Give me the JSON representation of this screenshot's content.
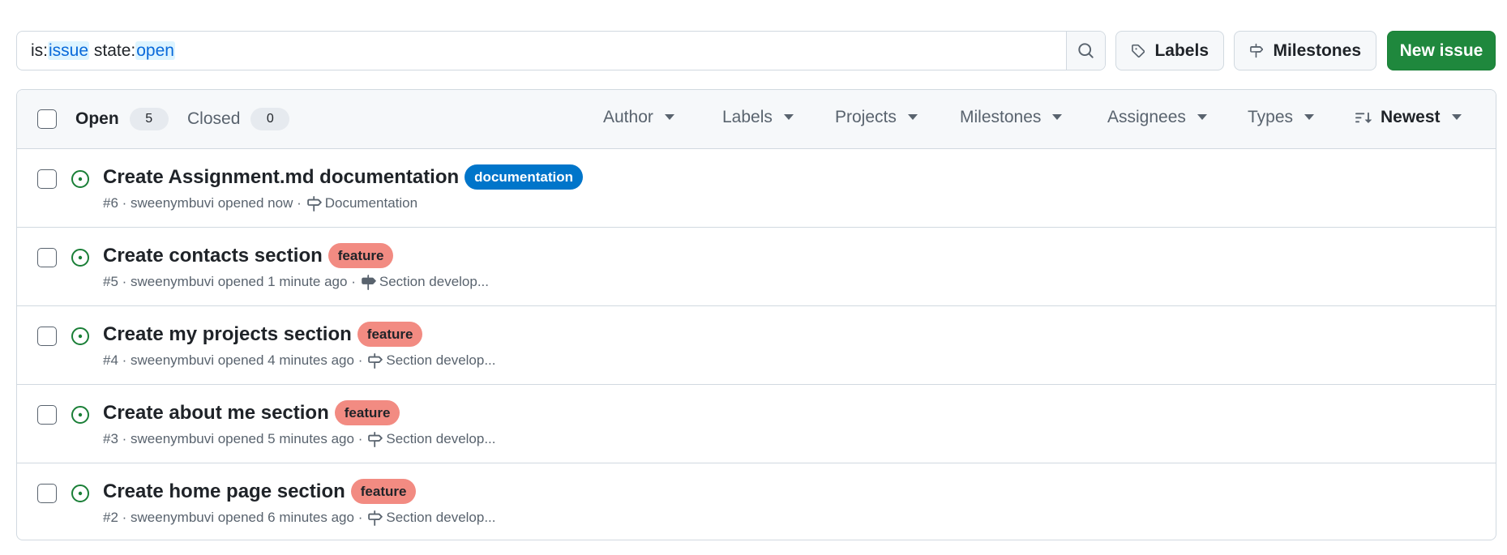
{
  "search": {
    "tokens": [
      {
        "key": "is:",
        "value": "issue"
      },
      {
        "key": " state:",
        "value": "open"
      }
    ]
  },
  "toolbar": {
    "labels_button": "Labels",
    "milestones_button": "Milestones",
    "new_issue_button": "New issue"
  },
  "header": {
    "open_label": "Open",
    "open_count": "5",
    "closed_label": "Closed",
    "closed_count": "0",
    "filters": {
      "author": "Author",
      "labels": "Labels",
      "projects": "Projects",
      "milestones": "Milestones",
      "assignees": "Assignees",
      "types": "Types",
      "sort": "Newest"
    }
  },
  "issues": [
    {
      "title": "Create Assignment.md documentation",
      "label": "documentation",
      "meta": "#6 · sweenymbuvi opened now ·",
      "milestone": "Documentation"
    },
    {
      "title": "Create contacts section",
      "label": "feature",
      "meta": "#5 · sweenymbuvi opened 1 minute ago ·",
      "milestone": "Section develop..."
    },
    {
      "title": "Create my projects section",
      "label": "feature",
      "meta": "#4 · sweenymbuvi opened 4 minutes ago ·",
      "milestone": "Section develop..."
    },
    {
      "title": "Create about me section",
      "label": "feature",
      "meta": "#3 · sweenymbuvi opened 5 minutes ago ·",
      "milestone": "Section develop..."
    },
    {
      "title": "Create home page section",
      "label": "feature",
      "meta": "#2 · sweenymbuvi opened 6 minutes ago ·",
      "milestone": "Section develop..."
    }
  ],
  "colors": {
    "primary_button": "#1f883d",
    "open_status": "#1a7f37",
    "label_documentation": "#0075ca",
    "label_feature": "#f28b82"
  },
  "icons": {
    "search": "search-icon",
    "labels": "tag-icon",
    "milestones": "milestone-icon",
    "issue_open": "issue-opened-icon",
    "sort": "sort-desc-icon",
    "dropdown": "triangle-down-icon"
  }
}
